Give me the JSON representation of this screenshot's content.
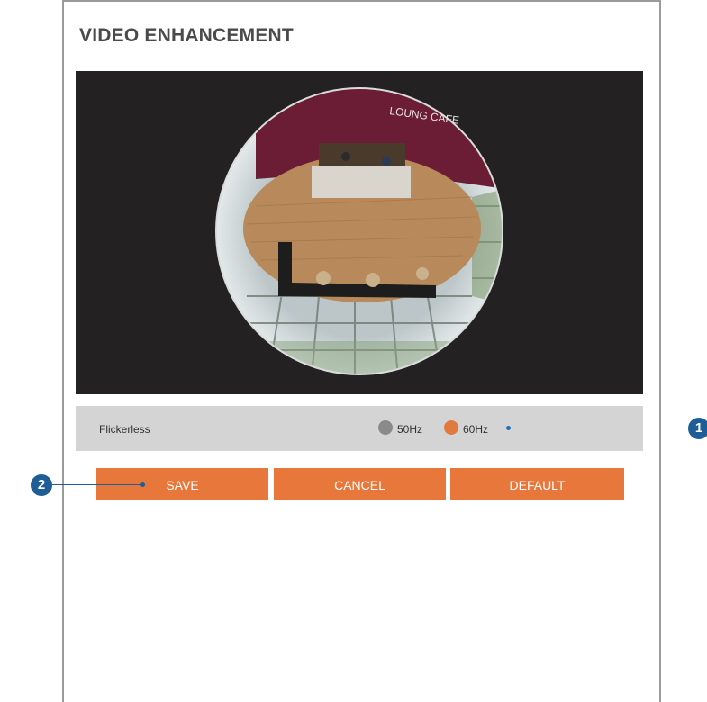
{
  "page": {
    "title": "VIDEO ENHANCEMENT"
  },
  "video": {
    "overlay_text": "LOUNG CAFE"
  },
  "flickerless": {
    "label": "Flickerless",
    "options": [
      {
        "label": "50Hz",
        "selected": false
      },
      {
        "label": "60Hz",
        "selected": true
      }
    ]
  },
  "buttons": {
    "save": "SAVE",
    "cancel": "CANCEL",
    "default": "DEFAULT"
  },
  "callouts": {
    "one": "1",
    "two": "2"
  },
  "colors": {
    "accent": "#e8773c",
    "callout": "#1e5d96"
  }
}
